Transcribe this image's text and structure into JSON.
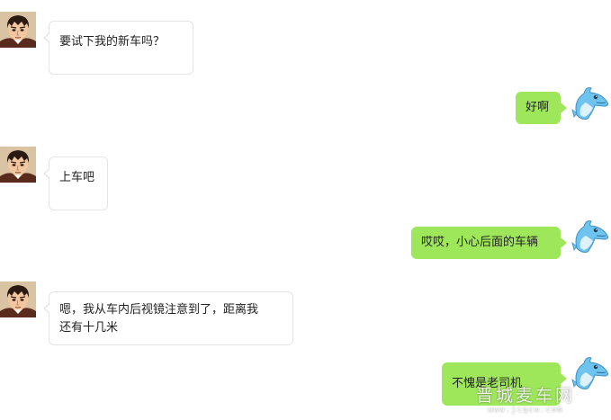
{
  "conversation": {
    "messages": [
      {
        "sender": "friend",
        "avatar": "man-avatar-icon",
        "text": "要试下我的新车吗？"
      },
      {
        "sender": "self",
        "avatar": "dolphin-avatar-icon",
        "text": "好啊"
      },
      {
        "sender": "friend",
        "avatar": "man-avatar-icon",
        "text": "上车吧"
      },
      {
        "sender": "self",
        "avatar": "dolphin-avatar-icon",
        "text": "哎哎，小心后面的车辆"
      },
      {
        "sender": "friend",
        "avatar": "man-avatar-icon",
        "text": "嗯，我从车内后视镜注意到了，距离我\n还有十几米"
      },
      {
        "sender": "self",
        "avatar": "dolphin-avatar-icon",
        "text": "不愧是老司机"
      }
    ]
  },
  "watermark": {
    "title": "晋城麦车网",
    "url": "www.jcqcw.com"
  },
  "colors": {
    "self_bubble": "#9ee75a",
    "friend_bubble": "#ffffff",
    "friend_border": "#e4e4e4"
  }
}
